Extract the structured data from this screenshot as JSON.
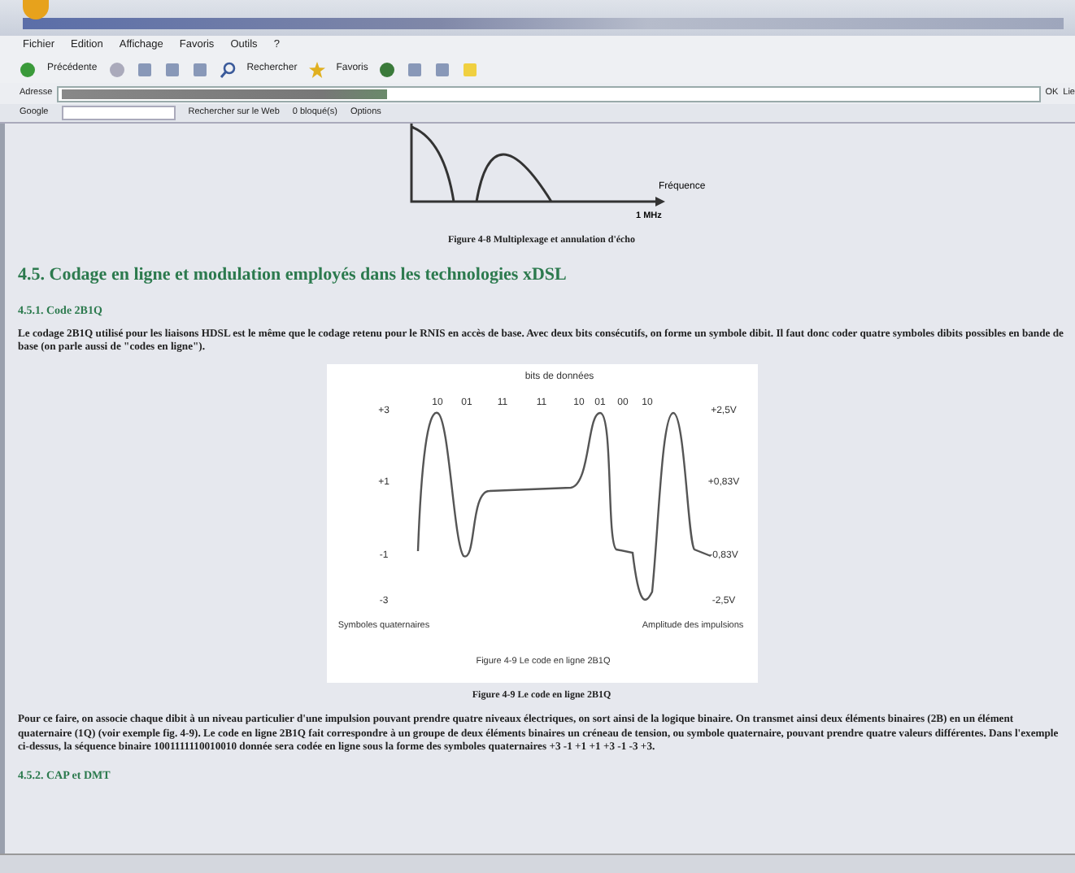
{
  "menu_bar": [
    "Fichier",
    "Edition",
    "Affichage",
    "Favoris",
    "Outils",
    "?"
  ],
  "toolbar": {
    "back": "Précédente",
    "search": "Rechercher",
    "favorites": "Favoris"
  },
  "address_bar": {
    "label": "Adresse",
    "go": "OK",
    "links": "Lie"
  },
  "google_bar": {
    "label": "Google",
    "search": "Rechercher sur le Web",
    "blocked": "0 bloqué(s)",
    "options": "Options"
  },
  "content": [
    {
      "kind": "spectrum-figure",
      "axis_label": "Fréquence",
      "tick": "1 MHz"
    },
    {
      "kind": "caption",
      "text": "Figure 4-8 Multiplexage et annulation d'écho"
    },
    {
      "kind": "heading",
      "text": "4.5. Codage en ligne et modulation employés dans les technologies xDSL"
    },
    {
      "kind": "subheading",
      "text": "4.5.1. Code 2B1Q"
    },
    {
      "kind": "paragraph",
      "text": "Le codage 2B1Q utilisé pour les liaisons HDSL est le même que le codage retenu pour le RNIS en accès de base. Avec deux bits consécutifs, on forme un symbole dibit. Il faut donc coder quatre symboles dibits possibles en bande de base (on parle aussi de \"codes en ligne\")."
    },
    {
      "kind": "signal-figure",
      "title": "bits de données",
      "bits": [
        "10",
        "01",
        "11",
        "11",
        "10",
        "01",
        "00",
        "10"
      ],
      "levels": [
        "+3",
        "+1",
        "-1",
        "-3"
      ],
      "voltages": [
        "+2,5V",
        "+0,83V",
        "-0,83V",
        "-2,5V"
      ],
      "left_caption": "Symboles quaternaires",
      "right_caption": "Amplitude des impulsions",
      "inner_caption": "Figure 4-9 Le code en ligne 2B1Q"
    },
    {
      "kind": "caption",
      "text": "Figure 4-9 Le code en ligne 2B1Q"
    },
    {
      "kind": "paragraph",
      "text": "Pour ce faire, on associe chaque dibit à un niveau particulier d'une impulsion pouvant prendre quatre niveaux électriques, on sort ainsi de la logique binaire. On transmet ainsi deux éléments binaires (2B) en un élément quaternaire (1Q) (voir exemple fig. 4-9). Le code en ligne 2B1Q fait correspondre à un groupe de deux éléments binaires un créneau de tension, ou symbole quaternaire, pouvant prendre quatre valeurs différentes. Dans l'exemple ci-dessus, la séquence binaire 1001111110010010 donnée sera codée en ligne sous la forme des symboles quaternaires +3 -1 +1 +1 +3 -1 -3 +3."
    },
    {
      "kind": "subheading",
      "text": "4.5.2. CAP et DMT"
    }
  ]
}
